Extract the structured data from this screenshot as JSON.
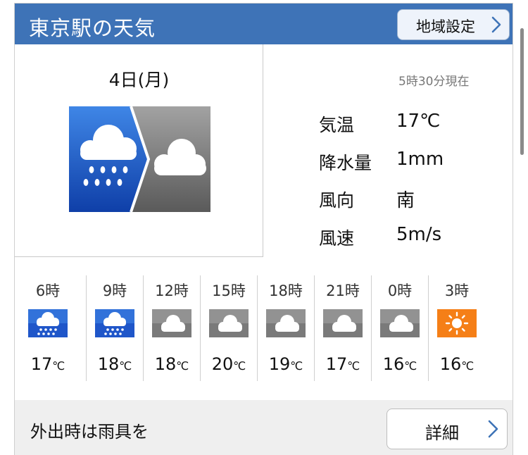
{
  "header": {
    "title": "東京駅の天気",
    "region_button": "地域設定"
  },
  "current": {
    "date": "4日(月)",
    "observed_at": "5時30分現在",
    "icon": "rain-to-cloudy-icon",
    "stats": [
      {
        "label": "気温",
        "value": "17℃"
      },
      {
        "label": "降水量",
        "value": "1mm"
      },
      {
        "label": "風向",
        "value": "南"
      },
      {
        "label": "風速",
        "value": "5m/s"
      }
    ]
  },
  "hourly": [
    {
      "time": "6時",
      "icon": "rain-icon",
      "temp": "17",
      "unit": "℃"
    },
    {
      "time": "9時",
      "icon": "rain-icon",
      "temp": "18",
      "unit": "℃"
    },
    {
      "time": "12時",
      "icon": "cloud-icon",
      "temp": "18",
      "unit": "℃"
    },
    {
      "time": "15時",
      "icon": "cloud-icon",
      "temp": "20",
      "unit": "℃"
    },
    {
      "time": "18時",
      "icon": "cloud-icon",
      "temp": "19",
      "unit": "℃"
    },
    {
      "time": "21時",
      "icon": "cloud-icon",
      "temp": "17",
      "unit": "℃"
    },
    {
      "time": "0時",
      "icon": "cloud-icon",
      "temp": "16",
      "unit": "℃"
    },
    {
      "time": "3時",
      "icon": "sun-icon",
      "temp": "16",
      "unit": "℃"
    }
  ],
  "footer": {
    "note": "外出時は雨具を",
    "detail_button": "詳細"
  },
  "colors": {
    "header_blue": "#3e73b7",
    "rain_blue": "#1f56c9",
    "cloud_gray": "#7a7a7a",
    "sun_orange": "#f57f17"
  }
}
